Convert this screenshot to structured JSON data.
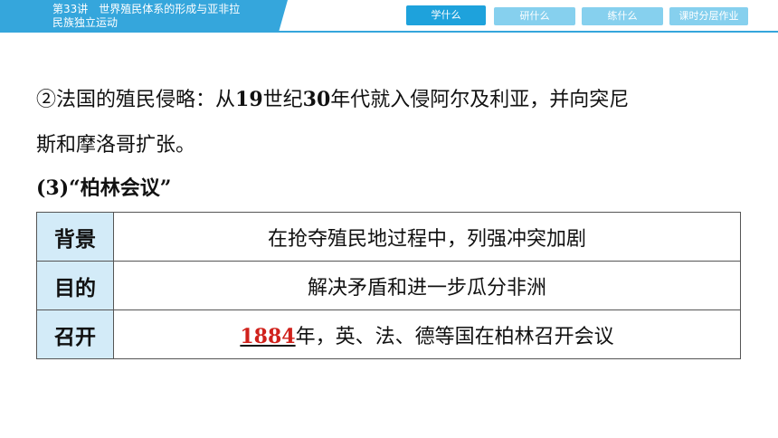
{
  "header": {
    "title_line1": "第33讲　世界殖民体系的形成与亚非拉",
    "title_line2": "民族独立运动",
    "tabs": [
      "学什么",
      "研什么",
      "练什么",
      "课时分层作业"
    ],
    "active_tab": "学什么"
  },
  "content": {
    "para1_prefix": "②法国的殖民侵略：从",
    "para1_num1": "19",
    "para1_mid1": "世纪",
    "para1_num2": "30",
    "para1_suffix": "年代就入侵阿尔及利亚，并向突尼",
    "para2": "斯和摩洛哥扩张。",
    "section_heading": "(3)“柏林会议”"
  },
  "table": {
    "rows": [
      {
        "header": "背景",
        "value": "在抢夺殖民地过程中，列强冲突加剧"
      },
      {
        "header": "目的",
        "value": "解决矛盾和进一步瓜分非洲"
      },
      {
        "header": "召开",
        "answer": "1884",
        "value": "年，英、法、德等国在柏林召开会议"
      }
    ]
  },
  "colors": {
    "accent": "#35a6dc",
    "header_cell": "#d3ebf8",
    "answer": "#d0211b"
  }
}
